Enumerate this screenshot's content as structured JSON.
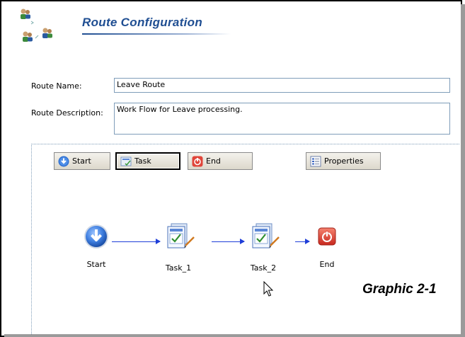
{
  "header": {
    "title": "Route Configuration"
  },
  "form": {
    "route_name_label": "Route Name:",
    "route_name_value": "Leave Route",
    "route_description_label": "Route Description:",
    "route_description_value": "Work Flow for Leave processing."
  },
  "toolbar": {
    "start_label": "Start",
    "task_label": "Task",
    "end_label": "End",
    "properties_label": "Properties"
  },
  "workflow": {
    "nodes": [
      {
        "label": "Start",
        "icon": "start-down-arrow-icon"
      },
      {
        "label": "Task_1",
        "icon": "task-document-icon"
      },
      {
        "label": "Task_2",
        "icon": "task-document-icon"
      },
      {
        "label": "End",
        "icon": "end-power-icon"
      }
    ]
  },
  "caption": "Graphic 2-1",
  "colors": {
    "title": "#1f4e92",
    "connector": "#1f3ed8",
    "start_node": "#2f6fd0",
    "end_node": "#e0453a"
  }
}
